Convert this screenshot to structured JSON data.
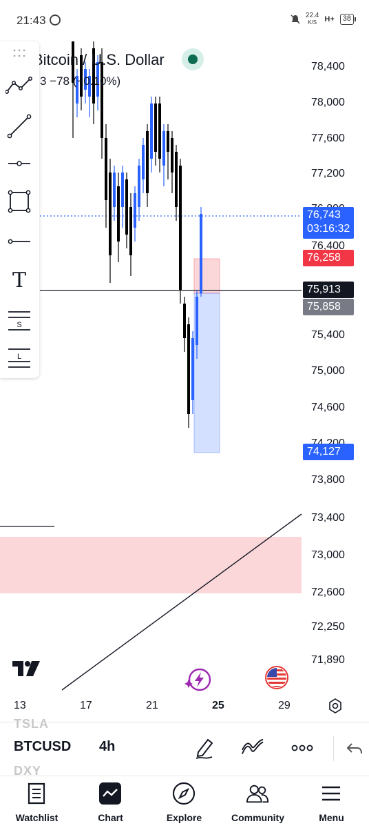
{
  "status_bar": {
    "time": "21:43",
    "net_speed_value": "22.4",
    "net_speed_unit": "K/S",
    "network": "H+",
    "battery": "38"
  },
  "chart_header": {
    "title": "Bitcoin / U.S. Dollar",
    "change_text": "3  −78 (−0.10%)",
    "market_status_color": "#0d6b52"
  },
  "price_axis": {
    "labels": [
      "78,400",
      "78,000",
      "77,600",
      "77,200",
      "76,800",
      "76,400",
      "75,400",
      "75,000",
      "74,600",
      "74,200",
      "73,800",
      "73,400",
      "73,000",
      "72,600",
      "72,250",
      "71,890"
    ],
    "last_price": "76,743",
    "countdown": "03:16:32",
    "stop_level": "76,258",
    "crosshair_price": "75,913",
    "entry_price": "75,858",
    "target_level": "74,127"
  },
  "time_axis": {
    "labels": [
      "13",
      "17",
      "21",
      "25",
      "29"
    ]
  },
  "toolbar": {
    "icons": [
      "trend-tools-icon",
      "trend-line-icon",
      "horizontal-ray-icon",
      "rectangle-icon",
      "horizontal-line-icon",
      "text-icon",
      "short-position-icon",
      "long-position-icon"
    ],
    "short_label": "S",
    "long_label": "L",
    "text_label": "T"
  },
  "symbol_bar": {
    "ghost_above": "TSLA",
    "symbol": "BTCUSD",
    "interval": "4h",
    "ghost_below": "DXY"
  },
  "bottom_nav": {
    "items": [
      {
        "label": "Watchlist",
        "icon": "watchlist-icon"
      },
      {
        "label": "Chart",
        "icon": "chart-icon"
      },
      {
        "label": "Explore",
        "icon": "compass-icon"
      },
      {
        "label": "Community",
        "icon": "community-icon"
      },
      {
        "label": "Menu",
        "icon": "menu-icon"
      }
    ]
  },
  "colors": {
    "bull": "#2962ff",
    "bear": "#000000",
    "last_price_tag": "#2962ff",
    "stop_tag": "#f23645",
    "crosshair_tag": "#131722",
    "entry_tag": "#787b86",
    "target_tag": "#2962ff",
    "stop_zone": "rgba(242,54,69,0.2)",
    "target_zone": "rgba(41,98,255,0.2)"
  }
}
